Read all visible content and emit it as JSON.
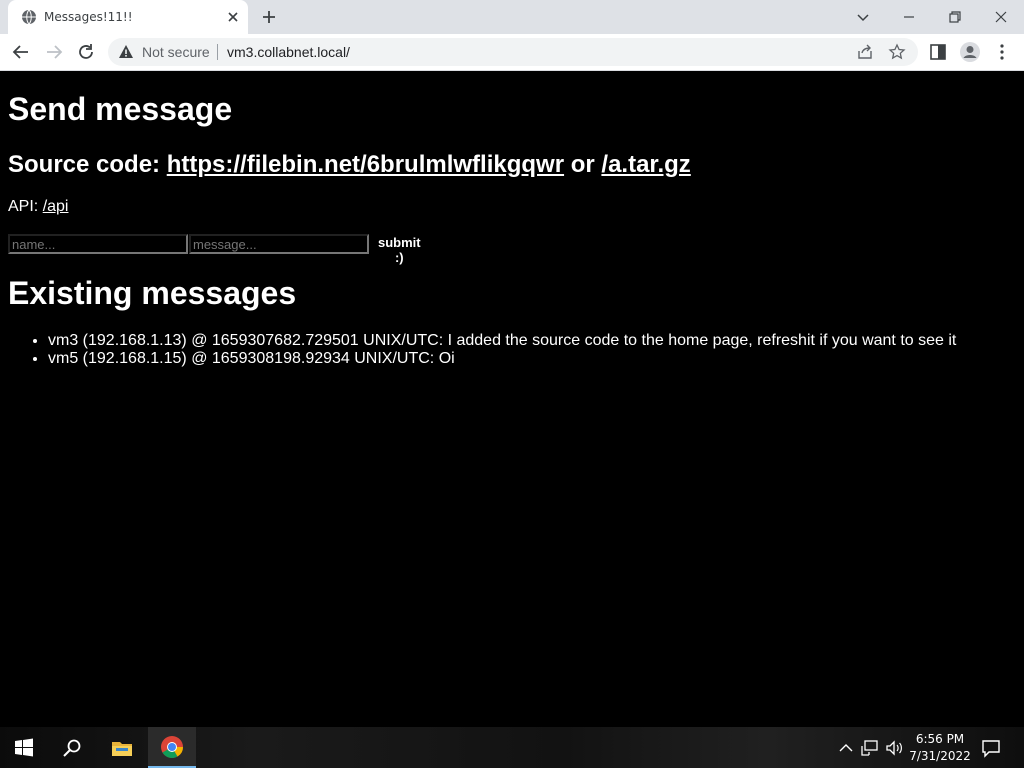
{
  "browser": {
    "tab_title": "Messages!11!!",
    "security_label": "Not secure",
    "url": "vm3.collabnet.local/"
  },
  "page": {
    "send_heading": "Send message",
    "source_prefix": "Source code: ",
    "source_link1": "https://filebin.net/6brulmlwflikgqwr",
    "source_or": " or ",
    "source_link2": "/a.tar.gz",
    "api_prefix": "API: ",
    "api_link": "/api",
    "name_placeholder": "name...",
    "message_placeholder": "message...",
    "submit_label": "submit :)",
    "existing_heading": "Existing messages",
    "messages": [
      "vm3 (192.168.1.13) @ 1659307682.729501 UNIX/UTC: I added the source code to the home page, refreshit if you want to see it",
      "vm5 (192.168.1.15) @ 1659308198.92934 UNIX/UTC: Oi"
    ]
  },
  "taskbar": {
    "time": "6:56 PM",
    "date": "7/31/2022",
    "icons": [
      "windows-start-icon",
      "search-icon",
      "file-explorer-icon",
      "chrome-icon"
    ]
  }
}
